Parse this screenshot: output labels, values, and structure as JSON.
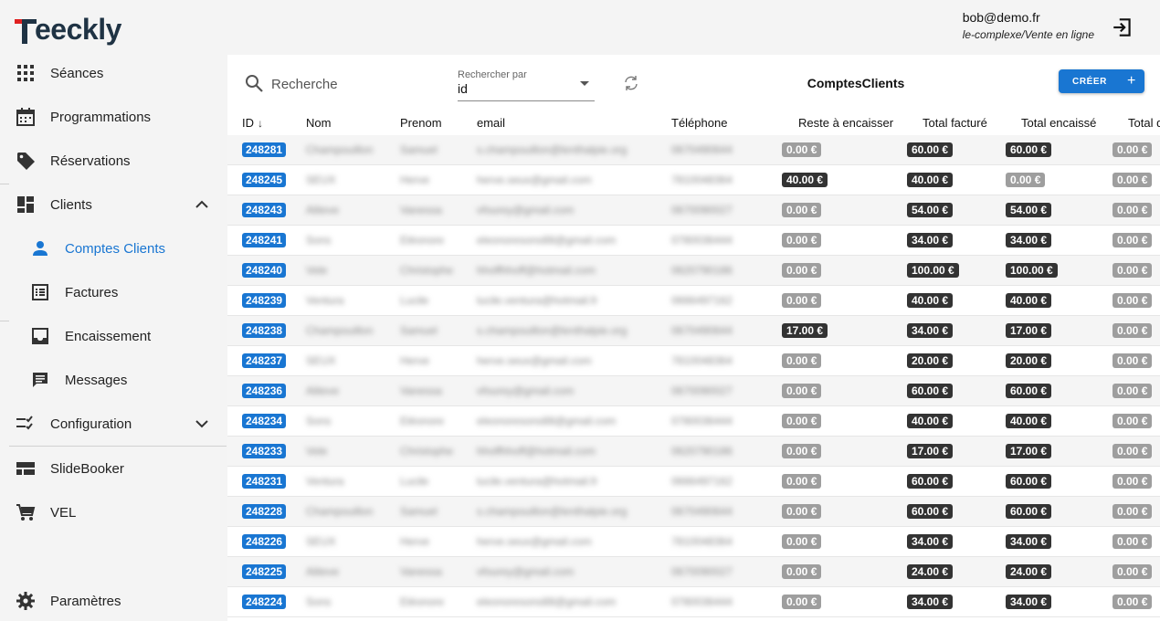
{
  "app": {
    "logo_text": "eeckly",
    "logo_full": "Teeckly"
  },
  "user": {
    "email": "bob@demo.fr",
    "context": "le-complexe/Vente en ligne"
  },
  "sidebar": {
    "items": [
      {
        "label": "Séances",
        "icon": "grid-icon"
      },
      {
        "label": "Programmations",
        "icon": "calendar-icon"
      },
      {
        "label": "Réservations",
        "icon": "tag-icon"
      },
      {
        "label": "Clients",
        "icon": "dashboard-icon"
      },
      {
        "label": "Comptes Clients",
        "icon": "person-icon"
      },
      {
        "label": "Factures",
        "icon": "list-icon"
      },
      {
        "label": "Encaissement",
        "icon": "inbox-icon"
      },
      {
        "label": "Messages",
        "icon": "message-icon"
      },
      {
        "label": "Configuration",
        "icon": "checklist-icon"
      },
      {
        "label": "SlideBooker",
        "icon": "view-icon"
      },
      {
        "label": "VEL",
        "icon": "cart-icon"
      },
      {
        "label": "Paramètres",
        "icon": "gear-icon"
      }
    ]
  },
  "toolbar": {
    "search_placeholder": "Recherche",
    "search_by_caption": "Rechercher par",
    "search_by_value": "id",
    "title": "ComptesClients",
    "create_label": "CRÉER"
  },
  "table": {
    "columns": [
      "ID",
      "Nom",
      "Prenom",
      "email",
      "Téléphone",
      "Reste à encaisser",
      "Total facturé",
      "Total encaissé",
      "Total d"
    ],
    "rows": [
      {
        "id": "248281",
        "nom": "Champouillon",
        "prenom": "Samuel",
        "email": "s.champouillon@lenthalpie.org",
        "tel": "0670490644",
        "reste": "0.00 €",
        "facture": "60.00 €",
        "encaisse": "60.00 €",
        "total_d": "0.00 €"
      },
      {
        "id": "248245",
        "nom": "SEUX",
        "prenom": "Herve",
        "email": "herve.seux@gmail.com",
        "tel": "7810048364",
        "reste": "40.00 €",
        "facture": "40.00 €",
        "encaisse": "0.00 €",
        "total_d": "0.00 €"
      },
      {
        "id": "248243",
        "nom": "Aliteve",
        "prenom": "Vanessa",
        "email": "vfourey@gmail.com",
        "tel": "0670090027",
        "reste": "0.00 €",
        "facture": "54.00 €",
        "encaisse": "54.00 €",
        "total_d": "0.00 €"
      },
      {
        "id": "248241",
        "nom": "Sons",
        "prenom": "Eléonore",
        "email": "eleonoresons88@gmail.com",
        "tel": "0780036444",
        "reste": "0.00 €",
        "facture": "34.00 €",
        "encaisse": "34.00 €",
        "total_d": "0.00 €"
      },
      {
        "id": "248240",
        "nom": "Vele",
        "prenom": "Christophe",
        "email": "hhoffhhoff@hotmail.com",
        "tel": "0620790186",
        "reste": "0.00 €",
        "facture": "100.00 €",
        "encaisse": "100.00 €",
        "total_d": "0.00 €"
      },
      {
        "id": "248239",
        "nom": "Ventura",
        "prenom": "Lucile",
        "email": "lucile.ventura@hotmail.fr",
        "tel": "0666497162",
        "reste": "0.00 €",
        "facture": "40.00 €",
        "encaisse": "40.00 €",
        "total_d": "0.00 €"
      },
      {
        "id": "248238",
        "nom": "Champouillon",
        "prenom": "Samuel",
        "email": "s.champouillon@lenthalpie.org",
        "tel": "0670490644",
        "reste": "17.00 €",
        "facture": "34.00 €",
        "encaisse": "17.00 €",
        "total_d": "0.00 €"
      },
      {
        "id": "248237",
        "nom": "SEUX",
        "prenom": "Herve",
        "email": "herve.seux@gmail.com",
        "tel": "7810048364",
        "reste": "0.00 €",
        "facture": "20.00 €",
        "encaisse": "20.00 €",
        "total_d": "0.00 €"
      },
      {
        "id": "248236",
        "nom": "Aliteve",
        "prenom": "Vanessa",
        "email": "vfourey@gmail.com",
        "tel": "0670090027",
        "reste": "0.00 €",
        "facture": "60.00 €",
        "encaisse": "60.00 €",
        "total_d": "0.00 €"
      },
      {
        "id": "248234",
        "nom": "Sons",
        "prenom": "Eléonore",
        "email": "eleonoresons88@gmail.com",
        "tel": "0780036444",
        "reste": "0.00 €",
        "facture": "40.00 €",
        "encaisse": "40.00 €",
        "total_d": "0.00 €"
      },
      {
        "id": "248233",
        "nom": "Vele",
        "prenom": "Christophe",
        "email": "hhoffhhoff@hotmail.com",
        "tel": "0620790186",
        "reste": "0.00 €",
        "facture": "17.00 €",
        "encaisse": "17.00 €",
        "total_d": "0.00 €"
      },
      {
        "id": "248231",
        "nom": "Ventura",
        "prenom": "Lucile",
        "email": "lucile.ventura@hotmail.fr",
        "tel": "0666497162",
        "reste": "0.00 €",
        "facture": "60.00 €",
        "encaisse": "60.00 €",
        "total_d": "0.00 €"
      },
      {
        "id": "248228",
        "nom": "Champouillon",
        "prenom": "Samuel",
        "email": "s.champouillon@lenthalpie.org",
        "tel": "0670490644",
        "reste": "0.00 €",
        "facture": "60.00 €",
        "encaisse": "60.00 €",
        "total_d": "0.00 €"
      },
      {
        "id": "248226",
        "nom": "SEUX",
        "prenom": "Herve",
        "email": "herve.seux@gmail.com",
        "tel": "7810048364",
        "reste": "0.00 €",
        "facture": "34.00 €",
        "encaisse": "34.00 €",
        "total_d": "0.00 €"
      },
      {
        "id": "248225",
        "nom": "Aliteve",
        "prenom": "Vanessa",
        "email": "vfourey@gmail.com",
        "tel": "0670090027",
        "reste": "0.00 €",
        "facture": "24.00 €",
        "encaisse": "24.00 €",
        "total_d": "0.00 €"
      },
      {
        "id": "248224",
        "nom": "Sons",
        "prenom": "Eléonore",
        "email": "eleonoresons88@gmail.com",
        "tel": "0780036444",
        "reste": "0.00 €",
        "facture": "34.00 €",
        "encaisse": "34.00 €",
        "total_d": "0.00 €"
      }
    ]
  },
  "colors": {
    "accent": "#1976d2",
    "badge_grey": "#9e9e9e",
    "badge_dark": "#333333",
    "logo_red": "#e02020",
    "logo_dark": "#1f3344"
  }
}
